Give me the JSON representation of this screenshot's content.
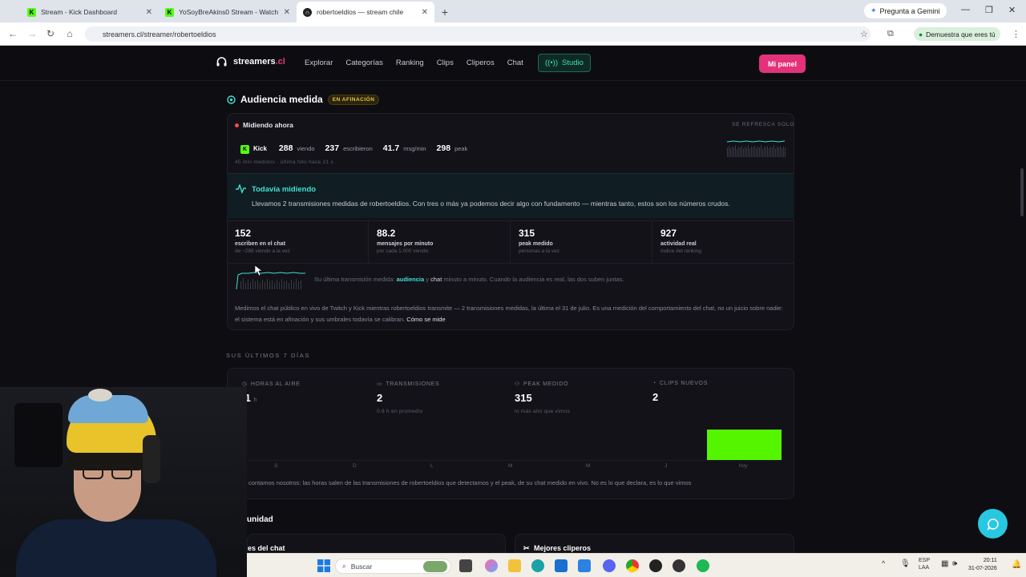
{
  "browser": {
    "tabs": [
      {
        "title": "Stream - Kick Dashboard",
        "favicon": "kick-icon"
      },
      {
        "title": "YoSoyBreAkins0 Stream - Watch",
        "favicon": "kick-icon"
      },
      {
        "title": "robertoeldios — stream chile",
        "favicon": "streamers-icon",
        "active": true
      }
    ],
    "gemini_label": "Pregunta a Gemini",
    "url": "streamers.cl/streamer/robertoeldios",
    "profile_label": "Demuestra que eres tú"
  },
  "site": {
    "logo_text": "streamers",
    "logo_tld": ".cl",
    "nav": [
      "Explorar",
      "Categorías",
      "Ranking",
      "Clips",
      "Cliperos",
      "Chat"
    ],
    "studio_label": "Studio",
    "panel_label": "Mi panel"
  },
  "audiencia": {
    "title": "Audiencia medida",
    "badge": "EN AFINACIÓN",
    "live_label": "Midiendo ahora",
    "refresh_label": "SE REFRESCA SOLO",
    "platform": "Kick",
    "viendo_value": "288",
    "viendo_label": "viendo",
    "escribieron_value": "237",
    "escribieron_label": "escribieron",
    "msgmin_value": "41.7",
    "msgmin_label": "msg/min",
    "peak_value": "298",
    "peak_label": "peak",
    "sub_note": "45 min medidos · última foto hace 21 s",
    "todavia_title": "Todavía midiendo",
    "todavia_text": "Llevamos 2 transmisiones medidas de robertoeldios. Con tres o más ya podemos decir algo con fundamento — mientras tanto, estos son los números crudos.",
    "metrics": [
      {
        "value": "152",
        "label": "escriben en el chat",
        "sub": "de ~288 viendo a la vez"
      },
      {
        "value": "88.2",
        "label": "mensajes por minuto",
        "sub": "por cada 1.000 viendo"
      },
      {
        "value": "315",
        "label": "peak medido",
        "sub": "personas a la vez"
      },
      {
        "value": "927",
        "label": "actividad real",
        "sub": "índice del ranking"
      }
    ],
    "chart_note_pre": "Su última transmisión medida:",
    "chart_note_a": "audiencia",
    "chart_note_mid": "y",
    "chart_note_c": "chat",
    "chart_note_post": "minuto a minuto. Cuando la audiencia es real, las dos suben juntas.",
    "disclaimer": "Medimos el chat público en vivo de Twitch y Kick mientras robertoeldios transmite — 2 transmisiones medidas, la última el 31 de julio. Es una medición del comportamiento del chat, no un juicio sobre nadie: el sistema está en afinación y sus umbrales todavía se calibran.",
    "disclaimer_link": "Cómo se mide"
  },
  "week": {
    "section_label": "SUS ÚLTIMOS 7 DÍAS",
    "stats": [
      {
        "label": "HORAS AL AIRE",
        "value": ".1",
        "unit": "h",
        "sub": "",
        "icon": "clock-icon"
      },
      {
        "label": "TRANSMISIONES",
        "value": "2",
        "unit": "",
        "sub": "0.6 h en promedio",
        "icon": "calendar-icon"
      },
      {
        "label": "PEAK MEDIDO",
        "value": "315",
        "unit": "",
        "sub": "lo más alto que vimos",
        "icon": "people-icon"
      },
      {
        "label": "CLIPS NUEVOS",
        "value": "2",
        "unit": "",
        "sub": "",
        "icon": "clip-icon"
      }
    ],
    "days": [
      "S",
      "D",
      "L",
      "M",
      "M",
      "J",
      "hoy"
    ],
    "note": "contamos nosotros: las horas salen de las transmisiones de robertoeldios que detectamos y el peak, de su chat medido en vivo. No es lo que declara, es lo que vimos"
  },
  "comunidad": {
    "title": "unidad",
    "card_a": "es del chat",
    "card_b": "Mejores cliperos"
  },
  "taskbar": {
    "search_placeholder": "Buscar",
    "lang": "ESP",
    "lang2": "LAA",
    "time": "20:11",
    "date": "31-07-2026"
  },
  "colors": {
    "accent_teal": "#3fe0d0",
    "brand_pink": "#e3327a",
    "kick_green": "#53fc18",
    "bar_green": "#55f500"
  }
}
